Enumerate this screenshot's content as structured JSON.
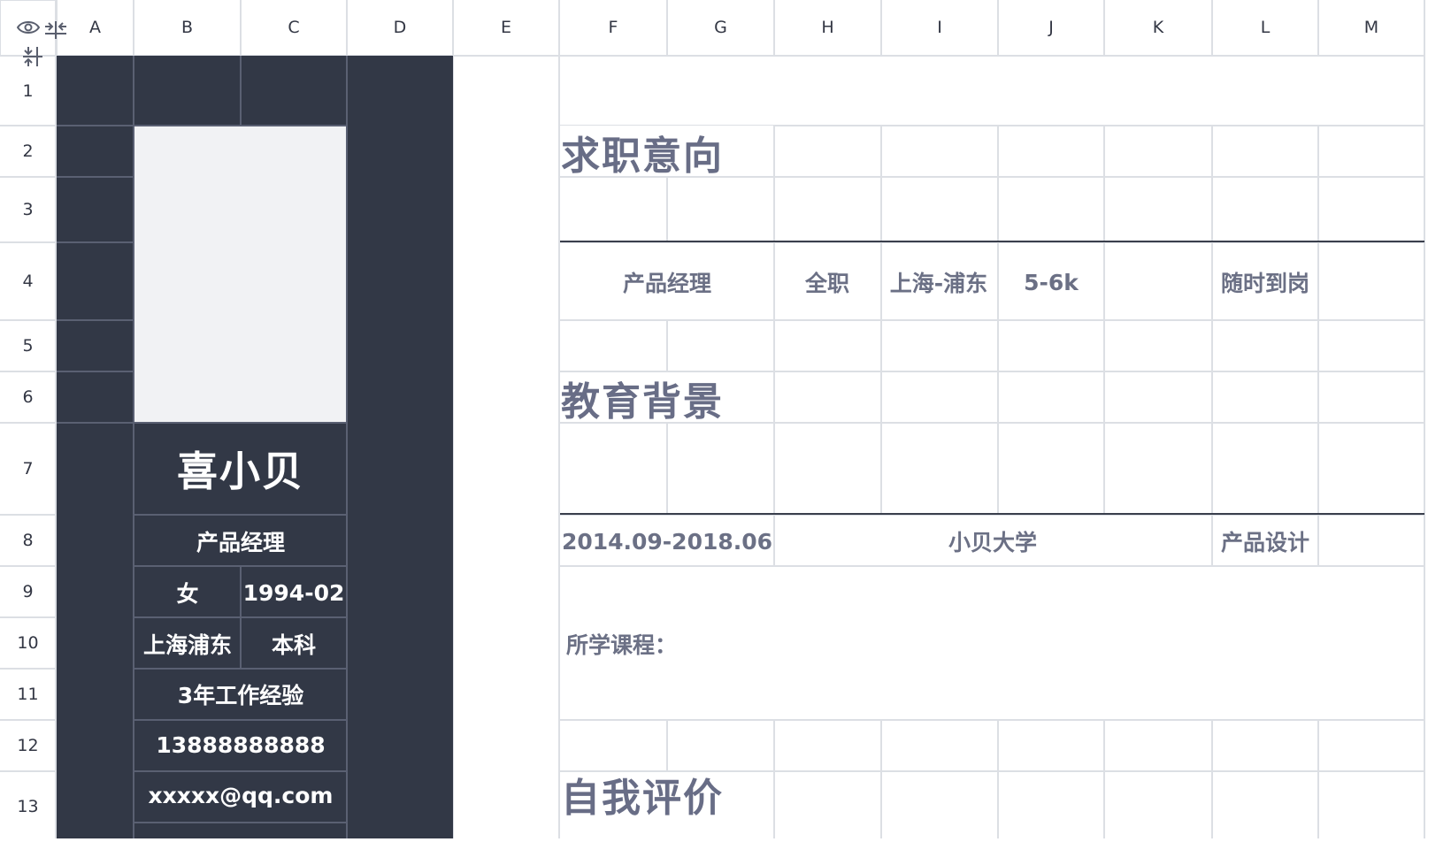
{
  "columns": [
    "A",
    "B",
    "C",
    "D",
    "E",
    "F",
    "G",
    "H",
    "I",
    "J",
    "K",
    "L",
    "M"
  ],
  "rows": [
    "1",
    "2",
    "3",
    "4",
    "5",
    "6",
    "7",
    "8",
    "9",
    "10",
    "11",
    "12",
    "13"
  ],
  "corner": {
    "icons": [
      "eye-icon",
      "freeze-columns-icon",
      "freeze-rows-icon"
    ]
  },
  "profile": {
    "name": "喜小贝",
    "title": "产品经理",
    "gender": "女",
    "birth": "1994-02",
    "location": "上海浦东",
    "degree": "本科",
    "experience": "3年工作经验",
    "phone": "13888888888",
    "email": "xxxxx@qq.com"
  },
  "job_intent": {
    "heading": "求职意向",
    "position": "产品经理",
    "type": "全职",
    "city": "上海-浦东",
    "salary": "5-6k",
    "availability": "随时到岗"
  },
  "education": {
    "heading": "教育背景",
    "period": "2014.09-2018.06",
    "school": "小贝大学",
    "major": "产品设计",
    "courses_label": "所学课程："
  },
  "self_eval": {
    "heading": "自我评价"
  },
  "colors": {
    "dark": "#323846",
    "photo_bg": "#f1f2f4",
    "grid": "#dcdfe4",
    "text": "#6b7085",
    "heading": "#686d86"
  }
}
